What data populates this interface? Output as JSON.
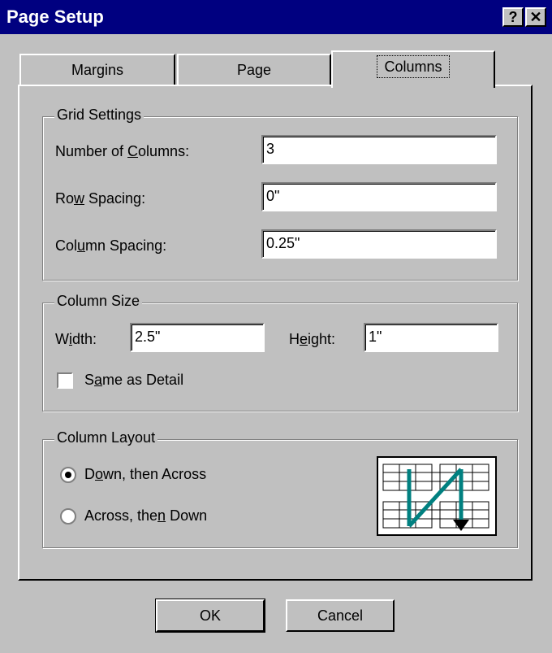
{
  "window": {
    "title": "Page Setup",
    "help_label": "?",
    "close_label": "✕"
  },
  "tabs": [
    {
      "label": "Margins"
    },
    {
      "label": "Page"
    },
    {
      "label": "Columns",
      "active": true
    }
  ],
  "grid_settings": {
    "legend": "Grid Settings",
    "number_of_columns": {
      "label_pre": "Number of ",
      "label_key": "C",
      "label_post": "olumns:",
      "value": "3"
    },
    "row_spacing": {
      "label_pre": "Ro",
      "label_key": "w",
      "label_post": " Spacing:",
      "value": "0\""
    },
    "column_spacing": {
      "label_pre": "Col",
      "label_key": "u",
      "label_post": "mn Spacing:",
      "value": "0.25\""
    }
  },
  "column_size": {
    "legend": "Column Size",
    "width": {
      "label_pre": "W",
      "label_key": "i",
      "label_post": "dth:",
      "value": "2.5\""
    },
    "height": {
      "label_pre": "H",
      "label_key": "e",
      "label_post": "ight:",
      "value": "1\""
    },
    "same_as_detail": {
      "label_pre": "S",
      "label_key": "a",
      "label_post": "me as Detail",
      "checked": false
    }
  },
  "column_layout": {
    "legend": "Column Layout",
    "options": [
      {
        "label_pre": "D",
        "label_key": "o",
        "label_post": "wn, then Across",
        "selected": true
      },
      {
        "label_pre": "Across, the",
        "label_key": "n",
        "label_post": " Down",
        "selected": false
      }
    ],
    "arrow_color": "#008080"
  },
  "buttons": {
    "ok": "OK",
    "cancel": "Cancel"
  }
}
